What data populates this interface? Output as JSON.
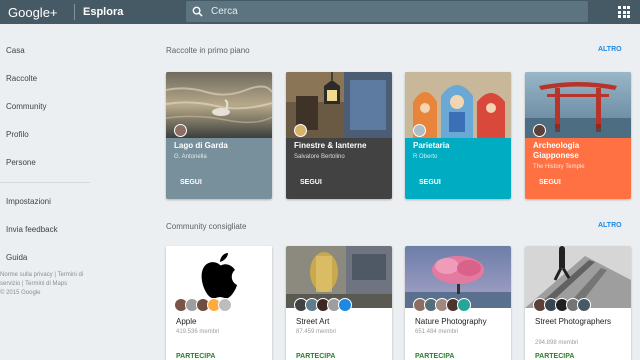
{
  "header": {
    "logo": "Google+",
    "title": "Esplora",
    "search_placeholder": "Cerca"
  },
  "sidebar": {
    "items": [
      {
        "label": "Casa"
      },
      {
        "label": "Raccolte"
      },
      {
        "label": "Community"
      },
      {
        "label": "Profilo"
      },
      {
        "label": "Persone"
      },
      {
        "label": "Impostazioni"
      },
      {
        "label": "Invia feedback"
      },
      {
        "label": "Guida"
      }
    ],
    "footer": {
      "line1": "Norme sulla privacy | Termini di",
      "line2": "servizio | Termini di Maps",
      "line3": "© 2015 Google"
    }
  },
  "featured": {
    "title": "Raccolte in primo piano",
    "more": "ALTRO",
    "cards": [
      {
        "title": "Lago di Garda",
        "owner": "G. Antonella",
        "action": "SEGUI",
        "color": "#78909c"
      },
      {
        "title": "Finestre & lanterne",
        "owner": "Salvatore Bertolino",
        "action": "SEGUI",
        "color": "#424242"
      },
      {
        "title": "Parietaria",
        "owner": "R Oberto",
        "action": "SEGUI",
        "color": "#00acc1"
      },
      {
        "title": "Archeologia Giapponese",
        "owner": "The History Temple",
        "action": "SEGUI",
        "color": "#ff7043"
      }
    ]
  },
  "communities": {
    "title": "Community consigliate",
    "more": "ALTRO",
    "cards": [
      {
        "name": "Apple",
        "members": "419.536 membri",
        "action": "PARTECIPA"
      },
      {
        "name": "Street Art",
        "members": "87.459 membri",
        "action": "PARTECIPA"
      },
      {
        "name": "Nature Photography",
        "members": "651.484 membri",
        "action": "PARTECIPA"
      },
      {
        "name": "Street Photographers",
        "members": "294.898 membri",
        "action": "PARTECIPA"
      }
    ]
  },
  "colors": {
    "topbar": "#455a64",
    "accent_link": "#1e88e5",
    "join_green": "#2e7d32"
  }
}
